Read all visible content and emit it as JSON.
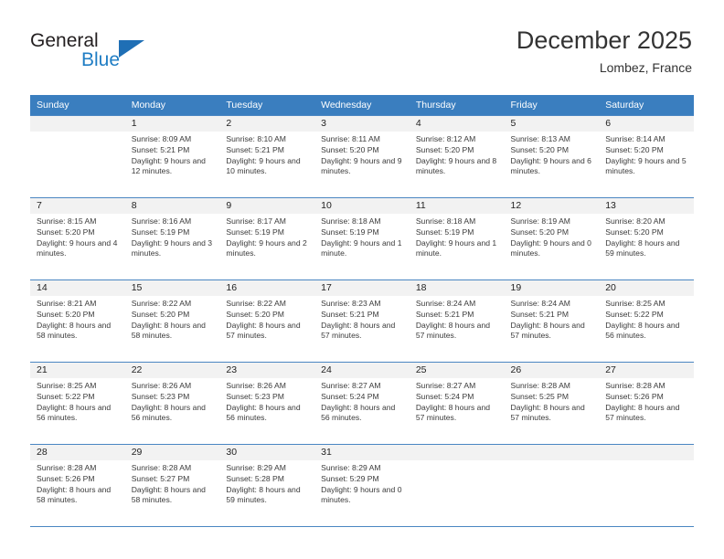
{
  "brand": {
    "name_top": "General",
    "name_bottom": "Blue",
    "accent_color": "#1f7dc4"
  },
  "header": {
    "title": "December 2025",
    "subtitle": "Lombez, France"
  },
  "calendar": {
    "header_bg": "#3a7ebf",
    "weekday_headers": [
      "Sunday",
      "Monday",
      "Tuesday",
      "Wednesday",
      "Thursday",
      "Friday",
      "Saturday"
    ],
    "weeks": [
      [
        {
          "blank": true,
          "day": ""
        },
        {
          "day": "1",
          "sunrise": "Sunrise: 8:09 AM",
          "sunset": "Sunset: 5:21 PM",
          "daylight": "Daylight: 9 hours and 12 minutes."
        },
        {
          "day": "2",
          "sunrise": "Sunrise: 8:10 AM",
          "sunset": "Sunset: 5:21 PM",
          "daylight": "Daylight: 9 hours and 10 minutes."
        },
        {
          "day": "3",
          "sunrise": "Sunrise: 8:11 AM",
          "sunset": "Sunset: 5:20 PM",
          "daylight": "Daylight: 9 hours and 9 minutes."
        },
        {
          "day": "4",
          "sunrise": "Sunrise: 8:12 AM",
          "sunset": "Sunset: 5:20 PM",
          "daylight": "Daylight: 9 hours and 8 minutes."
        },
        {
          "day": "5",
          "sunrise": "Sunrise: 8:13 AM",
          "sunset": "Sunset: 5:20 PM",
          "daylight": "Daylight: 9 hours and 6 minutes."
        },
        {
          "day": "6",
          "sunrise": "Sunrise: 8:14 AM",
          "sunset": "Sunset: 5:20 PM",
          "daylight": "Daylight: 9 hours and 5 minutes."
        }
      ],
      [
        {
          "day": "7",
          "sunrise": "Sunrise: 8:15 AM",
          "sunset": "Sunset: 5:20 PM",
          "daylight": "Daylight: 9 hours and 4 minutes."
        },
        {
          "day": "8",
          "sunrise": "Sunrise: 8:16 AM",
          "sunset": "Sunset: 5:19 PM",
          "daylight": "Daylight: 9 hours and 3 minutes."
        },
        {
          "day": "9",
          "sunrise": "Sunrise: 8:17 AM",
          "sunset": "Sunset: 5:19 PM",
          "daylight": "Daylight: 9 hours and 2 minutes."
        },
        {
          "day": "10",
          "sunrise": "Sunrise: 8:18 AM",
          "sunset": "Sunset: 5:19 PM",
          "daylight": "Daylight: 9 hours and 1 minute."
        },
        {
          "day": "11",
          "sunrise": "Sunrise: 8:18 AM",
          "sunset": "Sunset: 5:19 PM",
          "daylight": "Daylight: 9 hours and 1 minute."
        },
        {
          "day": "12",
          "sunrise": "Sunrise: 8:19 AM",
          "sunset": "Sunset: 5:20 PM",
          "daylight": "Daylight: 9 hours and 0 minutes."
        },
        {
          "day": "13",
          "sunrise": "Sunrise: 8:20 AM",
          "sunset": "Sunset: 5:20 PM",
          "daylight": "Daylight: 8 hours and 59 minutes."
        }
      ],
      [
        {
          "day": "14",
          "sunrise": "Sunrise: 8:21 AM",
          "sunset": "Sunset: 5:20 PM",
          "daylight": "Daylight: 8 hours and 58 minutes."
        },
        {
          "day": "15",
          "sunrise": "Sunrise: 8:22 AM",
          "sunset": "Sunset: 5:20 PM",
          "daylight": "Daylight: 8 hours and 58 minutes."
        },
        {
          "day": "16",
          "sunrise": "Sunrise: 8:22 AM",
          "sunset": "Sunset: 5:20 PM",
          "daylight": "Daylight: 8 hours and 57 minutes."
        },
        {
          "day": "17",
          "sunrise": "Sunrise: 8:23 AM",
          "sunset": "Sunset: 5:21 PM",
          "daylight": "Daylight: 8 hours and 57 minutes."
        },
        {
          "day": "18",
          "sunrise": "Sunrise: 8:24 AM",
          "sunset": "Sunset: 5:21 PM",
          "daylight": "Daylight: 8 hours and 57 minutes."
        },
        {
          "day": "19",
          "sunrise": "Sunrise: 8:24 AM",
          "sunset": "Sunset: 5:21 PM",
          "daylight": "Daylight: 8 hours and 57 minutes."
        },
        {
          "day": "20",
          "sunrise": "Sunrise: 8:25 AM",
          "sunset": "Sunset: 5:22 PM",
          "daylight": "Daylight: 8 hours and 56 minutes."
        }
      ],
      [
        {
          "day": "21",
          "sunrise": "Sunrise: 8:25 AM",
          "sunset": "Sunset: 5:22 PM",
          "daylight": "Daylight: 8 hours and 56 minutes."
        },
        {
          "day": "22",
          "sunrise": "Sunrise: 8:26 AM",
          "sunset": "Sunset: 5:23 PM",
          "daylight": "Daylight: 8 hours and 56 minutes."
        },
        {
          "day": "23",
          "sunrise": "Sunrise: 8:26 AM",
          "sunset": "Sunset: 5:23 PM",
          "daylight": "Daylight: 8 hours and 56 minutes."
        },
        {
          "day": "24",
          "sunrise": "Sunrise: 8:27 AM",
          "sunset": "Sunset: 5:24 PM",
          "daylight": "Daylight: 8 hours and 56 minutes."
        },
        {
          "day": "25",
          "sunrise": "Sunrise: 8:27 AM",
          "sunset": "Sunset: 5:24 PM",
          "daylight": "Daylight: 8 hours and 57 minutes."
        },
        {
          "day": "26",
          "sunrise": "Sunrise: 8:28 AM",
          "sunset": "Sunset: 5:25 PM",
          "daylight": "Daylight: 8 hours and 57 minutes."
        },
        {
          "day": "27",
          "sunrise": "Sunrise: 8:28 AM",
          "sunset": "Sunset: 5:26 PM",
          "daylight": "Daylight: 8 hours and 57 minutes."
        }
      ],
      [
        {
          "day": "28",
          "sunrise": "Sunrise: 8:28 AM",
          "sunset": "Sunset: 5:26 PM",
          "daylight": "Daylight: 8 hours and 58 minutes."
        },
        {
          "day": "29",
          "sunrise": "Sunrise: 8:28 AM",
          "sunset": "Sunset: 5:27 PM",
          "daylight": "Daylight: 8 hours and 58 minutes."
        },
        {
          "day": "30",
          "sunrise": "Sunrise: 8:29 AM",
          "sunset": "Sunset: 5:28 PM",
          "daylight": "Daylight: 8 hours and 59 minutes."
        },
        {
          "day": "31",
          "sunrise": "Sunrise: 8:29 AM",
          "sunset": "Sunset: 5:29 PM",
          "daylight": "Daylight: 9 hours and 0 minutes."
        },
        {
          "blank": true,
          "day": ""
        },
        {
          "blank": true,
          "day": ""
        },
        {
          "blank": true,
          "day": ""
        }
      ]
    ]
  }
}
